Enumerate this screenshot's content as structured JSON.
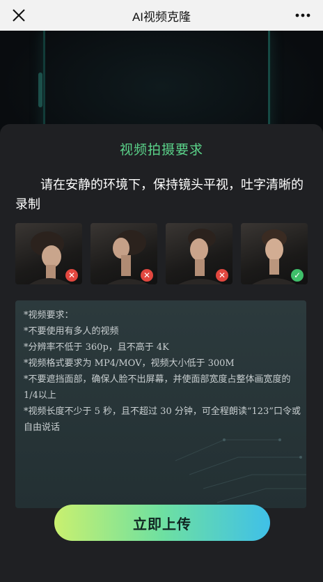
{
  "navbar": {
    "title": "AI视频克隆",
    "close_icon": "close-icon",
    "more_icon": "more-icon"
  },
  "sheet": {
    "title": "视频拍摄要求",
    "description": "请在安静的环境下，保持镜头平视，吐字清晰的录制",
    "examples": [
      {
        "pose": "head-tilted-down",
        "status": "error",
        "icon": "x-icon",
        "status_color": "#e2473f"
      },
      {
        "pose": "profile-looking-up",
        "status": "error",
        "icon": "x-icon",
        "status_color": "#e2473f"
      },
      {
        "pose": "three-quarter-turn",
        "status": "error",
        "icon": "x-icon",
        "status_color": "#e2473f"
      },
      {
        "pose": "front-facing",
        "status": "ok",
        "icon": "check-icon",
        "status_color": "#3fbf6a"
      }
    ],
    "requirements": [
      "*视频要求：",
      "*不要使用有多人的视频",
      "*分辨率不低于 360p，且不高于 4K",
      "*视频格式要求为 MP4/MOV，视频大小低于 300M",
      "*不要遮挡面部，确保人脸不出屏幕，并使面部宽度占整体画宽度的1/4以上",
      "*视频长度不少于 5 秒，且不超过 30 分钟，可全程朗读“123”口令或自由说话"
    ],
    "upload_label": "立即上传"
  },
  "colors": {
    "title_green": "#5bd38a",
    "sheet_bg": "#1f2023",
    "button_gradient": [
      "#c9f06f",
      "#6ee0a1",
      "#3fc0e8"
    ]
  }
}
